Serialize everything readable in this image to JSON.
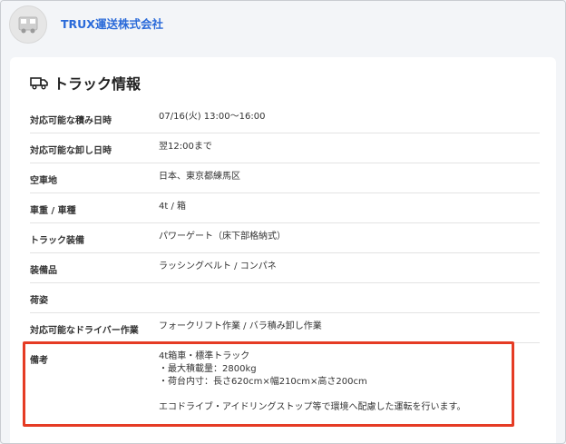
{
  "header": {
    "company_name": "TRUX運送株式会社",
    "avatar_icon": "truck-icon"
  },
  "section": {
    "title": "トラック情報",
    "title_icon": "truck-icon"
  },
  "rows": [
    {
      "label": "対応可能な積み日時",
      "value": "07/16(火) 13:00〜16:00"
    },
    {
      "label": "対応可能な卸し日時",
      "value": "翌12:00まで"
    },
    {
      "label": "空車地",
      "value": "日本、東京都練馬区"
    },
    {
      "label": "車重 / 車種",
      "value": "4t / 箱"
    },
    {
      "label": "トラック装備",
      "value": "パワーゲート（床下部格納式）"
    },
    {
      "label": "装備品",
      "value": "ラッシングベルト / コンパネ"
    },
    {
      "label": "荷姿",
      "value": ""
    },
    {
      "label": "対応可能なドライバー作業",
      "value": "フォークリフト作業 / バラ積み卸し作業"
    },
    {
      "label": "備考",
      "value": "4t箱車・標準トラック\n・最大積載量：2800kg\n・荷台内寸：長さ620cm×幅210cm×高さ200cm\n\nエコドライブ・アイドリングストップ等で環境へ配慮した運転を行います。"
    }
  ],
  "colors": {
    "accent": "#2a6ad9",
    "highlight": "#e53b24"
  }
}
